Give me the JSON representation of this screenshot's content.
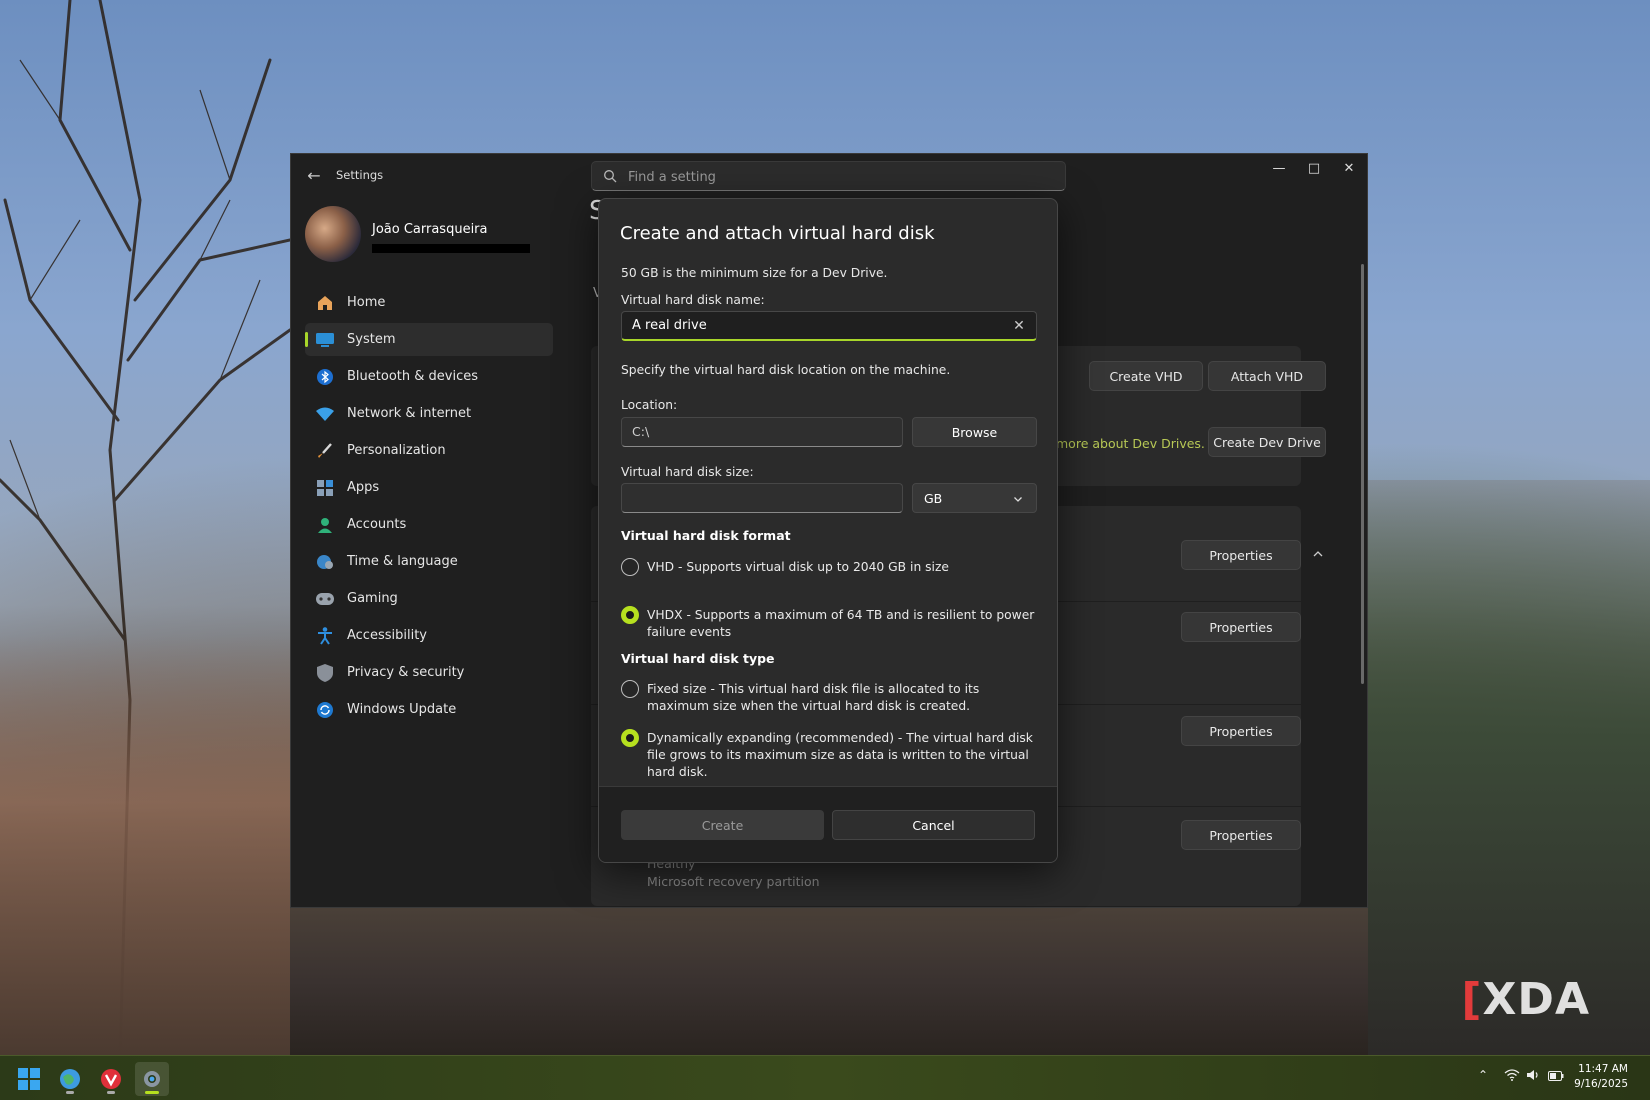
{
  "watermark": "XDA",
  "window": {
    "title": "Settings",
    "search_placeholder": "Find a setting",
    "controls": [
      "minimize",
      "maximize",
      "close"
    ]
  },
  "profile": {
    "name": "João Carrasqueira"
  },
  "nav": {
    "items": [
      {
        "label": "Home",
        "icon": "home-icon",
        "selected": false
      },
      {
        "label": "System",
        "icon": "system-icon",
        "selected": true
      },
      {
        "label": "Bluetooth & devices",
        "icon": "bluetooth-icon",
        "selected": false
      },
      {
        "label": "Network & internet",
        "icon": "wifi-icon",
        "selected": false
      },
      {
        "label": "Personalization",
        "icon": "brush-icon",
        "selected": false
      },
      {
        "label": "Apps",
        "icon": "apps-icon",
        "selected": false
      },
      {
        "label": "Accounts",
        "icon": "person-icon",
        "selected": false
      },
      {
        "label": "Time & language",
        "icon": "globe-clock-icon",
        "selected": false
      },
      {
        "label": "Gaming",
        "icon": "gamepad-icon",
        "selected": false
      },
      {
        "label": "Accessibility",
        "icon": "accessibility-icon",
        "selected": false
      },
      {
        "label": "Privacy & security",
        "icon": "shield-icon",
        "selected": false
      },
      {
        "label": "Windows Update",
        "icon": "update-icon",
        "selected": false
      }
    ]
  },
  "background_page": {
    "heading_fragment": "S",
    "section_fragment": "V",
    "create_vhd": "Create VHD",
    "attach_vhd": "Attach VHD",
    "dev_drive_link": "more about Dev Drives.",
    "create_dev_drive": "Create Dev Drive",
    "properties": "Properties",
    "partition_status": "Healthy",
    "partition_desc": "Microsoft recovery partition"
  },
  "dialog": {
    "title": "Create and attach virtual hard disk",
    "min_note": "50 GB is the minimum size for a Dev Drive.",
    "name_label": "Virtual hard disk name:",
    "name_value": "A real drive",
    "location_note": "Specify the virtual hard disk location on the machine.",
    "location_label": "Location:",
    "location_value": "C:\\",
    "browse": "Browse",
    "size_label": "Virtual hard disk size:",
    "size_value": "",
    "size_unit": "GB",
    "format_heading": "Virtual hard disk format",
    "format_options": [
      {
        "label": "VHD - Supports virtual disk up to 2040 GB in size",
        "selected": false
      },
      {
        "label": "VHDX - Supports a maximum of 64 TB and is resilient to power failure events",
        "selected": true
      }
    ],
    "type_heading": "Virtual hard disk type",
    "type_options": [
      {
        "label": "Fixed size - This virtual hard disk file is allocated to its maximum size when the virtual hard disk is created.",
        "selected": false
      },
      {
        "label": "Dynamically expanding (recommended) - The virtual hard disk file grows to its maximum size as data is written to the virtual hard disk.",
        "selected": true
      }
    ],
    "create": "Create",
    "cancel": "Cancel"
  },
  "taskbar": {
    "apps": [
      "windows-start-icon",
      "browser-icon",
      "vivaldi-icon",
      "settings-gear-icon"
    ],
    "time": "11:47 AM",
    "date": "9/16/2025"
  },
  "colors": {
    "accent": "#b6e01f",
    "dialog_bg": "#2b2b2b",
    "window_bg": "#1f1f1f",
    "link": "#b7c855"
  }
}
